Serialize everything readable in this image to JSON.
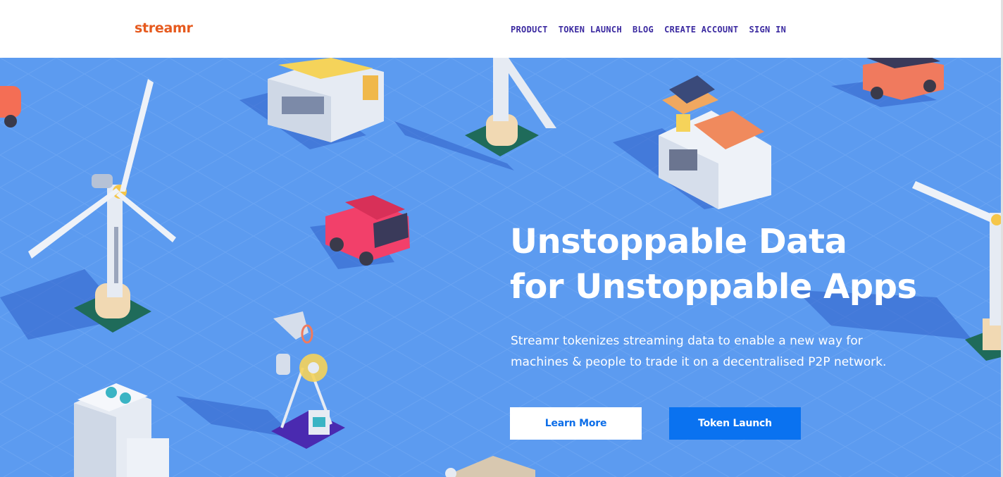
{
  "header": {
    "logo": "streamr",
    "nav": [
      {
        "label": "PRODUCT"
      },
      {
        "label": "TOKEN LAUNCH"
      },
      {
        "label": "BLOG"
      },
      {
        "label": "CREATE ACCOUNT"
      },
      {
        "label": "SIGN IN"
      }
    ]
  },
  "hero": {
    "headline_line1": "Unstoppable Data",
    "headline_line2": "for Unstoppable Apps",
    "subtitle": "Streamr tokenizes streaming data to enable a new way for machines & people to trade it on a decentralised P2P network.",
    "learn_more_label": "Learn More",
    "token_launch_label": "Token Launch"
  },
  "colors": {
    "brand": "#e65a1e",
    "nav": "#3b2aa0",
    "hero_bg": "#5c9bf0",
    "primary_button": "#0a72f0"
  },
  "icons": [
    "wind-turbine-illustration",
    "car-illustration",
    "house-illustration",
    "weather-station-illustration"
  ]
}
